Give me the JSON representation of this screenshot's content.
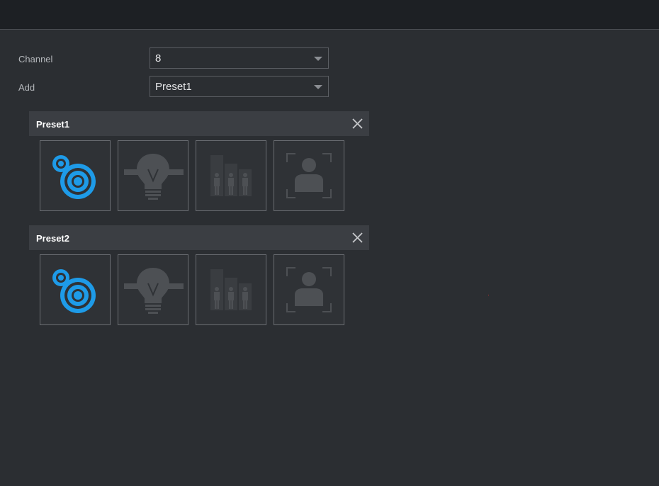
{
  "form": {
    "channel": {
      "label": "Channel",
      "value": "8"
    },
    "add": {
      "label": "Add",
      "value": "Preset1"
    }
  },
  "presets": [
    {
      "title": "Preset1",
      "tiles": [
        {
          "icon": "target-tracking-icon",
          "active": true
        },
        {
          "icon": "lightbulb-tripwire-icon",
          "active": false
        },
        {
          "icon": "people-counting-icon",
          "active": false
        },
        {
          "icon": "face-detection-icon",
          "active": false
        }
      ]
    },
    {
      "title": "Preset2",
      "tiles": [
        {
          "icon": "target-tracking-icon",
          "active": true
        },
        {
          "icon": "lightbulb-tripwire-icon",
          "active": false
        },
        {
          "icon": "people-counting-icon",
          "active": false
        },
        {
          "icon": "face-detection-icon",
          "active": false
        }
      ]
    }
  ],
  "colors": {
    "accent": "#1e9be8",
    "inactive_icon": "#4d5054",
    "background": "#2b2e32",
    "header": "#3b3e43"
  }
}
